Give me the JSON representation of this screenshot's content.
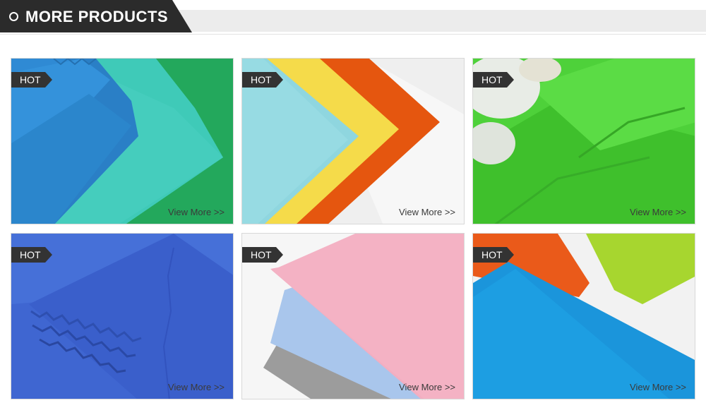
{
  "header": {
    "title": "MORE PRODUCTS"
  },
  "products": [
    {
      "badge": "HOT",
      "link": "View More >>"
    },
    {
      "badge": "HOT",
      "link": "View More >>"
    },
    {
      "badge": "HOT",
      "link": "View More >>"
    },
    {
      "badge": "HOT",
      "link": "View More >>"
    },
    {
      "badge": "HOT",
      "link": "View More >>"
    },
    {
      "badge": "HOT",
      "link": "View More >>"
    }
  ],
  "colors": {
    "header_dark": "#2b2b2b",
    "badge_bg": "#333333"
  }
}
